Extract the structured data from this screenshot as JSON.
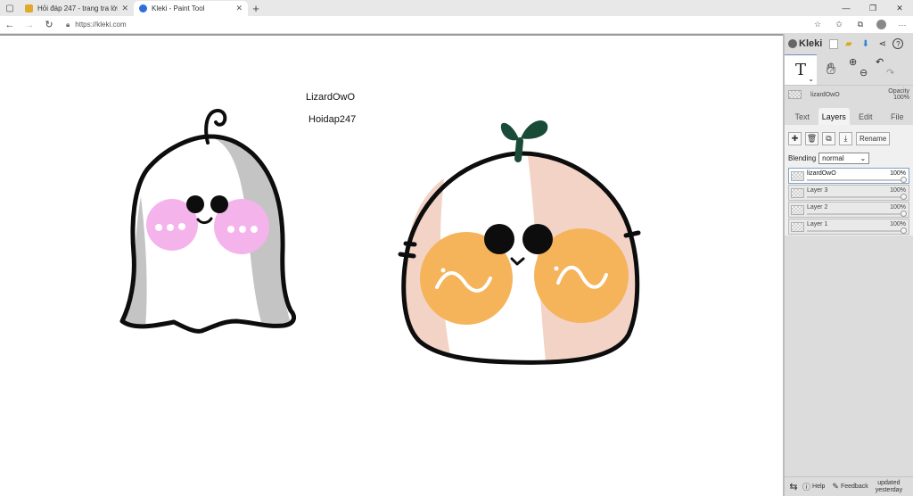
{
  "browser": {
    "tabs": [
      {
        "title": "Hỏi đáp 247 - trang tra lời",
        "favicon_color": "#e0a92b",
        "active": false
      },
      {
        "title": "Kleki - Paint Tool",
        "favicon_color": "#2f6fdc",
        "active": true
      }
    ],
    "url": "https://kleki.com",
    "new_tab_glyph": "+",
    "close_glyph": "✕"
  },
  "canvas": {
    "texts": [
      "LizardOwO",
      "Hoidap247"
    ],
    "colors": {
      "ghost_gray": "#c4c4c4",
      "ghost_cheek": "#f5b3ec",
      "bun_peach": "#f3d3c6",
      "bun_cheek": "#f5b35a",
      "sprout": "#1a4a38",
      "outline": "#0d0d0d"
    }
  },
  "sidebar": {
    "brand": "Kleki",
    "active_tool": "T",
    "layer_preview": {
      "name": "lizardOwO",
      "opacity_label": "Opacity",
      "opacity_value": "100%"
    },
    "tabs": [
      "Text",
      "Layers",
      "Edit",
      "File"
    ],
    "active_tab": "Layers",
    "rename_label": "Rename",
    "blending_label": "Blending",
    "blending_value": "normal",
    "layers": [
      {
        "name": "lizardOwO",
        "opacity": "100%",
        "active": true
      },
      {
        "name": "Layer 3",
        "opacity": "100%",
        "active": false
      },
      {
        "name": "Layer 2",
        "opacity": "100%",
        "active": false
      },
      {
        "name": "Layer 1",
        "opacity": "100%",
        "active": false
      }
    ],
    "footer": {
      "help": "Help",
      "feedback": "Feedback",
      "updated_line1": "updated",
      "updated_line2": "yesterday"
    }
  }
}
